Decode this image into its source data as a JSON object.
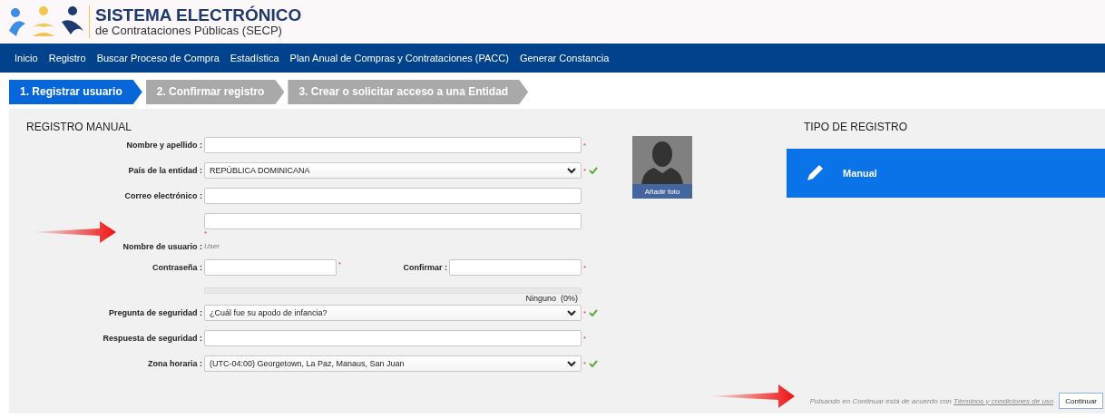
{
  "header": {
    "title": "SISTEMA ELECTRÓNICO",
    "subtitle": "de Contrataciones Públicas (SECP)"
  },
  "nav": [
    "Inicio",
    "Registro",
    "Buscar Proceso de Compra",
    "Estadística",
    "Plan Anual de Compras y Contrataciones (PACC)",
    "Generar Constancia"
  ],
  "steps": [
    {
      "label": "1. Registrar usuario",
      "selected": true
    },
    {
      "label": "2. Confirmar registro",
      "selected": false
    },
    {
      "label": "3. Crear o solicitar acceso a una Entidad",
      "selected": false
    }
  ],
  "form": {
    "title": "REGISTRO MANUAL",
    "fields": [
      {
        "kind": "text",
        "label": "Nombre y apellido :",
        "mark": "*"
      },
      {
        "kind": "select",
        "label": "País de la entidad :",
        "value": "REPÚBLICA DOMINICANA",
        "mark": "*",
        "valid": true
      },
      {
        "kind": "text",
        "label": "Correo electrónico :"
      },
      {
        "kind": "text",
        "note": "*"
      },
      {
        "kind": "info",
        "label": "Nombre de usuario :",
        "value": "User"
      },
      {
        "kind": "password",
        "label": "Contraseña :",
        "mark": "*",
        "confirm": {
          "label": "Confirmar :",
          "mark": "*"
        }
      },
      {
        "kind": "strength",
        "level": 0,
        "reading": "Ninguno  (0%)"
      },
      {
        "kind": "select",
        "label": "Pregunta de seguridad :",
        "value": "¿Cuál fue su apodo de infancia?",
        "mark": "*",
        "valid": true
      },
      {
        "kind": "text",
        "label": "Respuesta de seguridad :",
        "mark": "*"
      },
      {
        "kind": "select",
        "label": "Zona horaria :",
        "value": "(UTC-04:00) Georgetown, La Paz, Manaus, San Juan",
        "mark": "*",
        "valid": true
      }
    ],
    "photo_button": "Añadir foto"
  },
  "registration_type": {
    "title": "TIPO DE REGISTRO",
    "options": [
      {
        "label": "Manual",
        "selected": true
      }
    ]
  },
  "footer": {
    "notice": "Pulsando en Continuar está de acuerdo con",
    "link": "Términos y condiciones de uso",
    "button": "Continuar"
  }
}
